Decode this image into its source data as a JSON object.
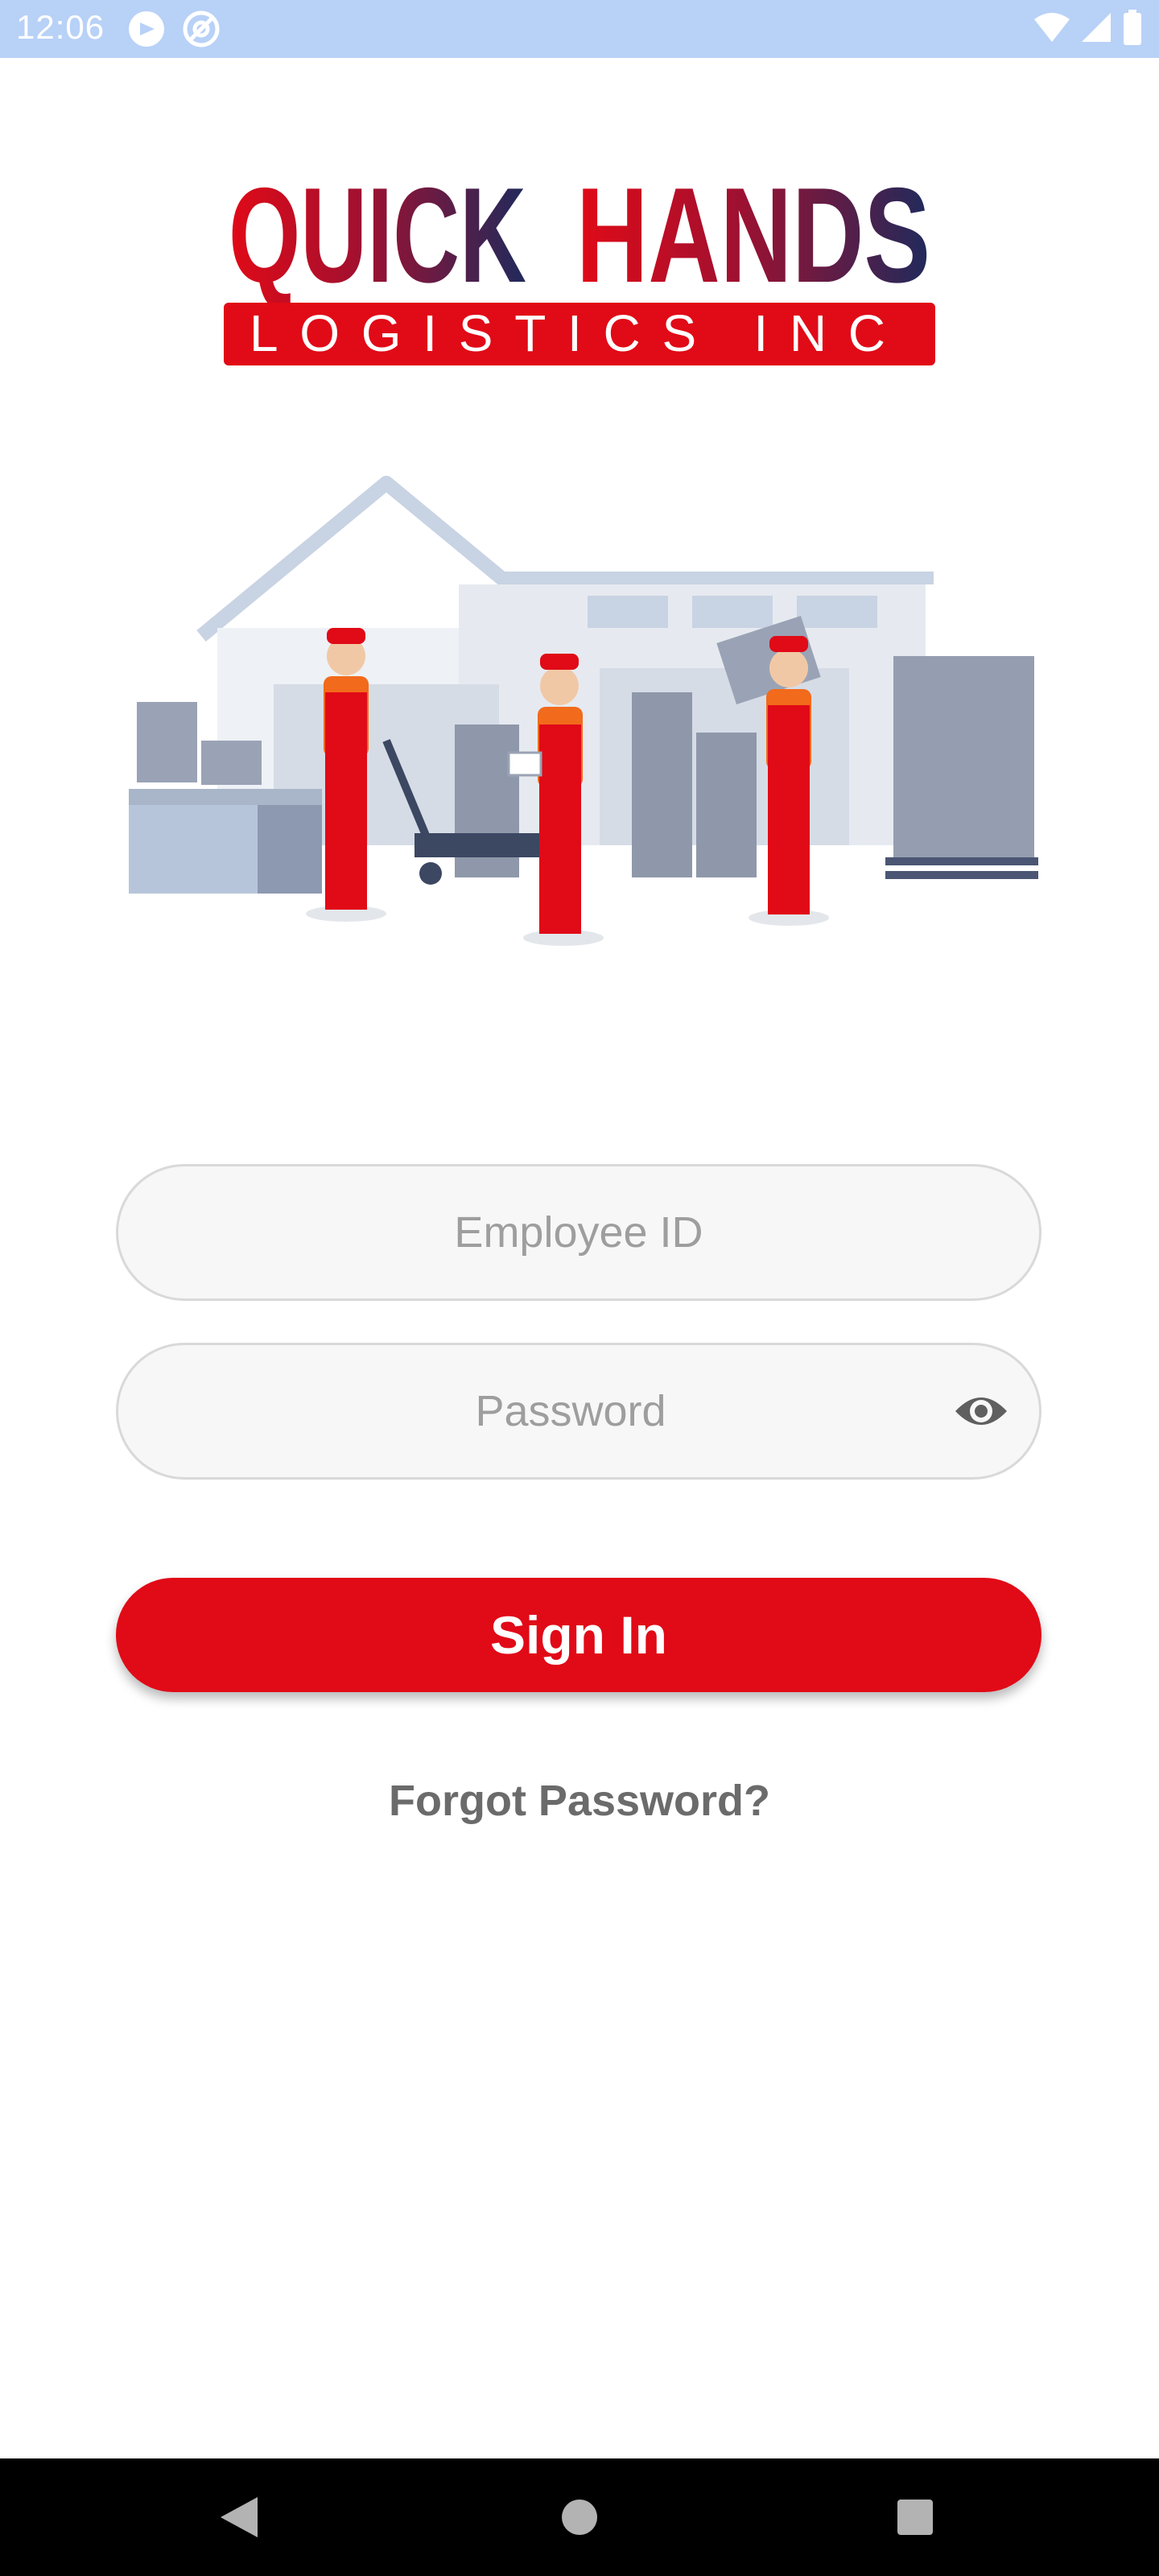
{
  "status_bar": {
    "time": "12:06",
    "icons": [
      "app-notification-icon",
      "app-notification-icon-2",
      "wifi-icon",
      "cellular-signal-icon",
      "battery-icon"
    ]
  },
  "logo": {
    "line1_part1": "QUICK",
    "line1_part2": "HANDS",
    "line2": "LOGISTICS INC",
    "colors": {
      "red": "#e10a17",
      "navy": "#1f2a5c"
    }
  },
  "illustration": {
    "icon": "warehouse-workers-illustration"
  },
  "login_form": {
    "employee_id_placeholder": "Employee ID",
    "employee_id_value": "",
    "password_placeholder": "Password",
    "password_value": "",
    "password_toggle_icon": "eye-icon",
    "sign_in_label": "Sign In",
    "forgot_password_label": "Forgot Password?"
  },
  "nav_bar": {
    "buttons": [
      "back-icon",
      "home-icon",
      "recents-icon"
    ]
  },
  "colors": {
    "accent": "#e10a17",
    "status_bar": "#b8d1f7",
    "field_background": "#f7f7f7",
    "field_border": "#d9d9d9",
    "placeholder": "#9e9e9e",
    "link": "#6b6b6b"
  }
}
